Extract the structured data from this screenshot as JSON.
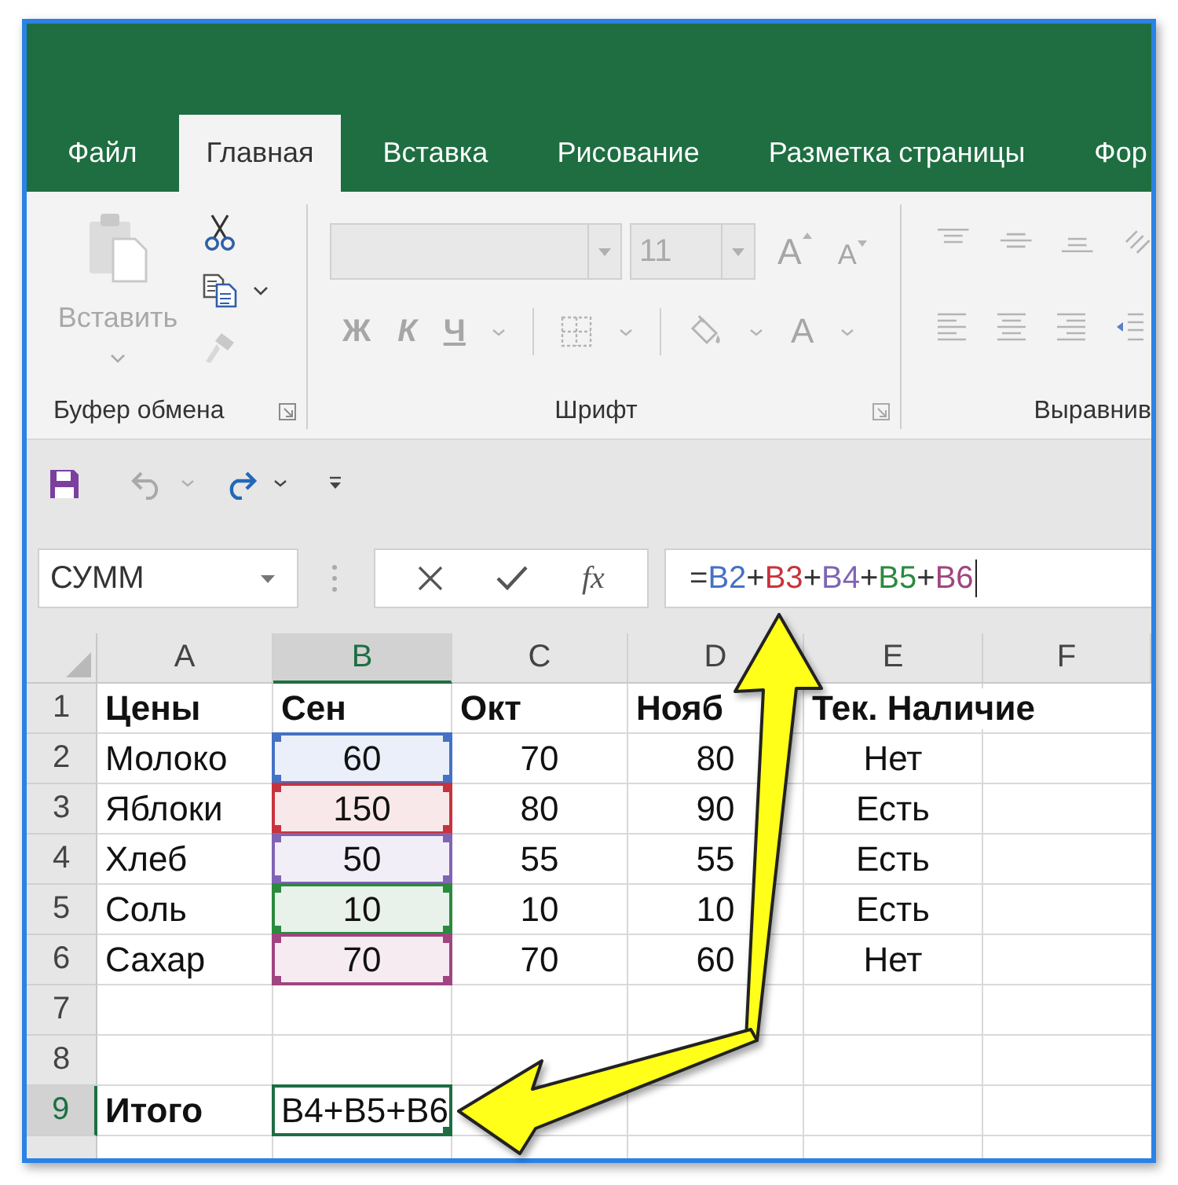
{
  "ribbon_tabs": [
    {
      "label": "Файл",
      "selected": false
    },
    {
      "label": "Главная",
      "selected": true
    },
    {
      "label": "Вставка",
      "selected": false
    },
    {
      "label": "Рисование",
      "selected": false
    },
    {
      "label": "Разметка страницы",
      "selected": false
    },
    {
      "label": "Фор",
      "selected": false
    }
  ],
  "ribbon": {
    "clipboard": {
      "paste": {
        "label": "Вставить",
        "disabled": true
      },
      "label": "Буфер обмена"
    },
    "font": {
      "disabled": true,
      "size": "11",
      "grow": "A",
      "shrink": "A",
      "styles": [
        {
          "label": "Ж",
          "kind": "bold"
        },
        {
          "label": "К",
          "kind": "italic"
        },
        {
          "label": "Ч",
          "kind": "underline"
        }
      ],
      "font_color": "A",
      "label": "Шрифт"
    },
    "alignment": {
      "disabled": true,
      "label": "Выравнив"
    }
  },
  "formula_bar": {
    "name_box": "СУММ",
    "function_button": "fx",
    "tokens": [
      {
        "text": "="
      },
      {
        "text": "B2",
        "color": "#4472c4"
      },
      {
        "text": "+"
      },
      {
        "text": "B3",
        "color": "#c8323c"
      },
      {
        "text": "+"
      },
      {
        "text": "B4",
        "color": "#8064b4"
      },
      {
        "text": "+"
      },
      {
        "text": "B5",
        "color": "#2a8a3e"
      },
      {
        "text": "+"
      },
      {
        "text": "B6",
        "color": "#a0457f"
      }
    ]
  },
  "sheet": {
    "columns": [
      {
        "label": "A",
        "selected": false
      },
      {
        "label": "B",
        "selected": true
      },
      {
        "label": "C",
        "selected": false
      },
      {
        "label": "D",
        "selected": false
      },
      {
        "label": "E",
        "selected": false
      },
      {
        "label": "F",
        "selected": false
      }
    ],
    "rows": [
      {
        "header": "1",
        "selected": false,
        "cells": [
          {
            "kind": "heading",
            "text": "Цены"
          },
          {
            "kind": "heading",
            "text": "Сен"
          },
          {
            "kind": "heading",
            "text": "Окт"
          },
          {
            "kind": "heading",
            "text": "Нояб"
          },
          {
            "kind": "heading",
            "text": "Тек. Наличие"
          },
          {
            "kind": "empty"
          }
        ]
      },
      {
        "header": "2",
        "selected": false,
        "cells": [
          {
            "kind": "value",
            "text": "Молоко"
          },
          {
            "kind": "value",
            "text": "60",
            "color": "#4472c4"
          },
          {
            "kind": "value",
            "text": "70"
          },
          {
            "kind": "value",
            "text": "80"
          },
          {
            "kind": "value",
            "text": "Нет"
          },
          {
            "kind": "empty"
          }
        ]
      },
      {
        "header": "3",
        "selected": false,
        "cells": [
          {
            "kind": "value",
            "text": "Яблоки"
          },
          {
            "kind": "value",
            "text": "150",
            "color": "#c8323c"
          },
          {
            "kind": "value",
            "text": "80"
          },
          {
            "kind": "value",
            "text": "90"
          },
          {
            "kind": "value",
            "text": "Есть"
          },
          {
            "kind": "empty"
          }
        ]
      },
      {
        "header": "4",
        "selected": false,
        "cells": [
          {
            "kind": "value",
            "text": "Хлеб"
          },
          {
            "kind": "value",
            "text": "50",
            "color": "#8064b4"
          },
          {
            "kind": "value",
            "text": "55"
          },
          {
            "kind": "value",
            "text": "55"
          },
          {
            "kind": "value",
            "text": "Есть"
          },
          {
            "kind": "empty"
          }
        ]
      },
      {
        "header": "5",
        "selected": false,
        "cells": [
          {
            "kind": "value",
            "text": "Соль"
          },
          {
            "kind": "value",
            "text": "10",
            "color": "#2a8a3e"
          },
          {
            "kind": "value",
            "text": "10"
          },
          {
            "kind": "value",
            "text": "10"
          },
          {
            "kind": "value",
            "text": "Есть"
          },
          {
            "kind": "empty"
          }
        ]
      },
      {
        "header": "6",
        "selected": false,
        "cells": [
          {
            "kind": "value",
            "text": "Сахар"
          },
          {
            "kind": "value",
            "text": "70",
            "color": "#a0457f"
          },
          {
            "kind": "value",
            "text": "70"
          },
          {
            "kind": "value",
            "text": "60"
          },
          {
            "kind": "value",
            "text": "Нет"
          },
          {
            "kind": "empty"
          }
        ]
      },
      {
        "header": "7",
        "selected": false,
        "cells": [
          {
            "kind": "empty"
          },
          {
            "kind": "empty"
          },
          {
            "kind": "empty"
          },
          {
            "kind": "empty"
          },
          {
            "kind": "empty"
          },
          {
            "kind": "empty"
          }
        ]
      },
      {
        "header": "8",
        "selected": false,
        "cells": [
          {
            "kind": "empty"
          },
          {
            "kind": "empty"
          },
          {
            "kind": "empty"
          },
          {
            "kind": "empty"
          },
          {
            "kind": "empty"
          },
          {
            "kind": "empty"
          }
        ]
      },
      {
        "header": "9",
        "selected": true,
        "cells": [
          {
            "kind": "heading",
            "text": "Итого"
          },
          {
            "kind": "editing",
            "text": "B4+B5+B6"
          },
          {
            "kind": "empty"
          },
          {
            "kind": "empty"
          },
          {
            "kind": "empty"
          },
          {
            "kind": "empty"
          }
        ]
      }
    ]
  }
}
